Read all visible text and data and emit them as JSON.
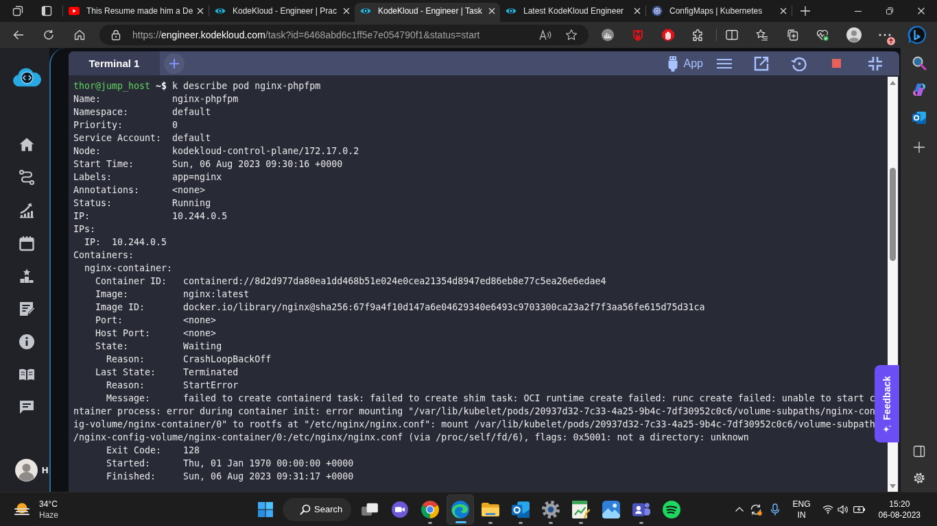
{
  "browser": {
    "tabs": [
      {
        "kind": "video",
        "title": "This Resume made him a De",
        "selected": false
      },
      {
        "kind": "eye",
        "title": "KodeKloud - Engineer | Prac",
        "selected": false
      },
      {
        "kind": "eye",
        "title": "KodeKloud - Engineer | Task",
        "selected": true
      },
      {
        "kind": "eye",
        "title": "Latest KodeKloud Engineer",
        "selected": false
      },
      {
        "kind": "wheel",
        "title": "ConfigMaps | Kubernetes",
        "selected": false
      }
    ],
    "address": {
      "scheme": "https://",
      "host": "engineer.kodekloud.com",
      "path": "/task?id=6468abd6c1ff5e7e054790f1&status=start"
    }
  },
  "sidebar": {
    "user_initial": "H"
  },
  "terminal": {
    "tabs": [
      {
        "label": "Terminal 1",
        "selected": true
      }
    ],
    "app_label": "App",
    "prompt": {
      "user_host": "thor@jump_host",
      "symbol": "~$",
      "command": "k describe pod nginx-phpfpm"
    },
    "output": [
      {
        "key": "Name:",
        "value": "nginx-phpfpm"
      },
      {
        "key": "Namespace:",
        "value": "default"
      },
      {
        "key": "Priority:",
        "value": "0"
      },
      {
        "key": "Service Account:",
        "value": "default"
      },
      {
        "key": "Node:",
        "value": "kodekloud-control-plane/172.17.0.2"
      },
      {
        "key": "Start Time:",
        "value": "Sun, 06 Aug 2023 09:30:16 +0000"
      },
      {
        "key": "Labels:",
        "value": "app=nginx"
      },
      {
        "key": "Annotations:",
        "value": "<none>"
      },
      {
        "key": "Status:",
        "value": "Running"
      },
      {
        "key": "IP:",
        "value": "10.244.0.5"
      },
      {
        "key": "IPs:",
        "children": [
          {
            "key": "IP:",
            "value": "10.244.0.5"
          }
        ]
      },
      {
        "key": "Containers:",
        "children": [
          {
            "key": "nginx-container:",
            "children": [
              {
                "key": "Container ID:",
                "value": "containerd://8d2d977da80ea1dd468b51e024e0cea21354d8947ed86eb8e77c5ea26e6edae4"
              },
              {
                "key": "Image:",
                "value": "nginx:latest"
              },
              {
                "key": "Image ID:",
                "value": "docker.io/library/nginx@sha256:67f9a4f10d147a6e04629340e6493c9703300ca23a2f7f3aa56fe615d75d31ca"
              },
              {
                "key": "Port:",
                "value": "<none>"
              },
              {
                "key": "Host Port:",
                "value": "<none>"
              },
              {
                "key": "State:",
                "value": "Waiting",
                "children": [
                  {
                    "key": "Reason:",
                    "value": "CrashLoopBackOff"
                  }
                ]
              },
              {
                "key": "Last State:",
                "value": "Terminated",
                "children": [
                  {
                    "key": "Reason:",
                    "value": "StartError"
                  },
                  {
                    "key": "Message:",
                    "value": "failed to create containerd task: failed to create shim task: OCI runtime create failed: runc create failed: unable to start c",
                    "wrapped": [
                      "ntainer process: error during container init: error mounting \"/var/lib/kubelet/pods/20937d32-7c33-4a25-9b4c-7df30952c0c6/volume-subpaths/nginx-con",
                      "ig-volume/nginx-container/0\" to rootfs at \"/etc/nginx/nginx.conf\": mount /var/lib/kubelet/pods/20937d32-7c33-4a25-9b4c-7df30952c0c6/volume-subpath",
                      "/nginx-config-volume/nginx-container/0:/etc/nginx/nginx.conf (via /proc/self/fd/6), flags: 0x5001: not a directory: unknown"
                    ]
                  },
                  {
                    "key": "Exit Code:",
                    "value": "128"
                  },
                  {
                    "key": "Started:",
                    "value": "Thu, 01 Jan 1970 00:00:00 +0000"
                  },
                  {
                    "key": "Finished:",
                    "value": "Sun, 06 Aug 2023 09:31:17 +0000"
                  }
                ]
              }
            ]
          }
        ]
      }
    ]
  },
  "feedback": {
    "label": "Feedback"
  },
  "taskbar": {
    "weather": {
      "temperature": "34°C",
      "condition": "Haze"
    },
    "search_label": "Search",
    "apps": [
      {
        "kind": "taskview",
        "running": false,
        "selected": false
      },
      {
        "kind": "meet",
        "running": false,
        "selected": false
      },
      {
        "kind": "chrome",
        "running": true,
        "selected": false
      },
      {
        "kind": "edge",
        "running": true,
        "selected": true
      },
      {
        "kind": "files",
        "running": true,
        "selected": false
      },
      {
        "kind": "mail",
        "running": true,
        "selected": false
      },
      {
        "kind": "settings",
        "running": true,
        "selected": false
      },
      {
        "kind": "sheet",
        "running": true,
        "selected": false
      },
      {
        "kind": "photos",
        "running": false,
        "selected": false
      },
      {
        "kind": "teams",
        "running": true,
        "selected": false
      },
      {
        "kind": "music",
        "running": false,
        "selected": false
      }
    ],
    "tray": {
      "language": "ENG",
      "region": "IN",
      "time": "15:20",
      "date": "06-08-2023"
    }
  }
}
